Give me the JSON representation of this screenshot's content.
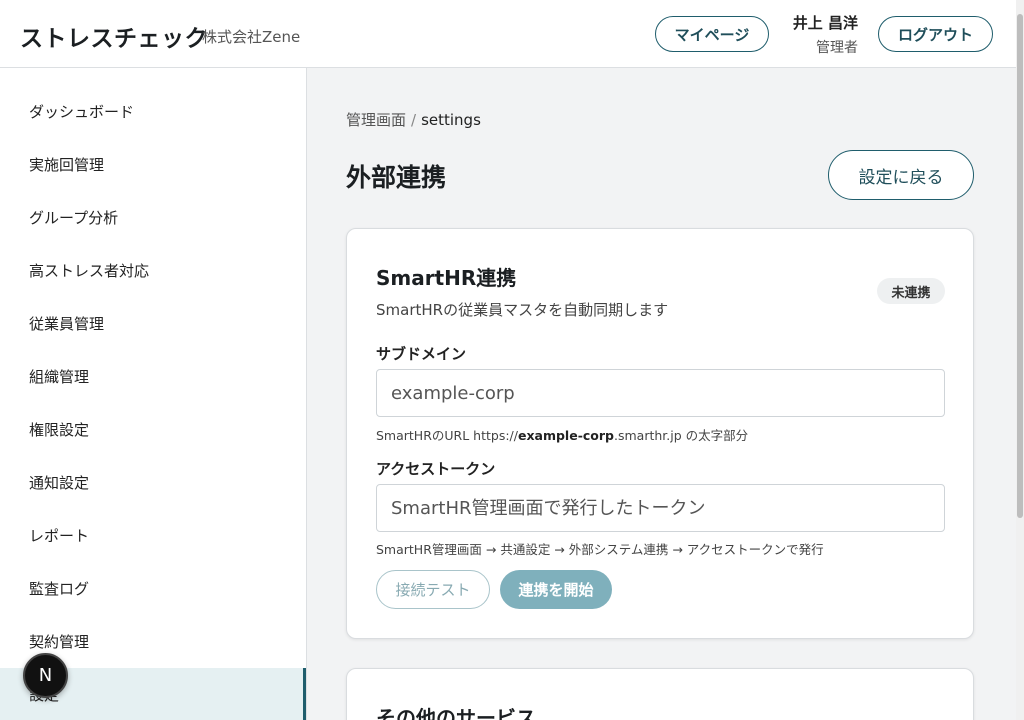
{
  "header": {
    "app_title": "ストレスチェック",
    "company": "株式会社Zene",
    "mypage_label": "マイページ",
    "user_name": "井上 昌洋",
    "user_role": "管理者",
    "logout_label": "ログアウト"
  },
  "sidebar": {
    "items": [
      {
        "label": "ダッシュボード"
      },
      {
        "label": "実施回管理"
      },
      {
        "label": "グループ分析"
      },
      {
        "label": "高ストレス者対応"
      },
      {
        "label": "従業員管理"
      },
      {
        "label": "組織管理"
      },
      {
        "label": "権限設定"
      },
      {
        "label": "通知設定"
      },
      {
        "label": "レポート"
      },
      {
        "label": "監査ログ"
      },
      {
        "label": "契約管理"
      },
      {
        "label": "設定",
        "active": true
      }
    ]
  },
  "breadcrumb": {
    "parent": "管理画面",
    "separator": "/",
    "current": "settings"
  },
  "page": {
    "title": "外部連携",
    "back_label": "設定に戻る"
  },
  "smarthr_card": {
    "title": "SmartHR連携",
    "description": "SmartHRの従業員マスタを自動同期します",
    "status": "未連携",
    "subdomain_label": "サブドメイン",
    "subdomain_placeholder": "example-corp",
    "subdomain_hint_pre": "SmartHRのURL https://",
    "subdomain_hint_bold": "example-corp",
    "subdomain_hint_post": ".smarthr.jp の太字部分",
    "token_label": "アクセストークン",
    "token_placeholder": "SmartHR管理画面で発行したトークン",
    "token_hint": "SmartHR管理画面 → 共通設定 → 外部システム連携 → アクセストークンで発行",
    "test_label": "接続テスト",
    "start_label": "連携を開始"
  },
  "other_card": {
    "title": "その他のサービス"
  },
  "dev_badge": {
    "letter": "N"
  }
}
